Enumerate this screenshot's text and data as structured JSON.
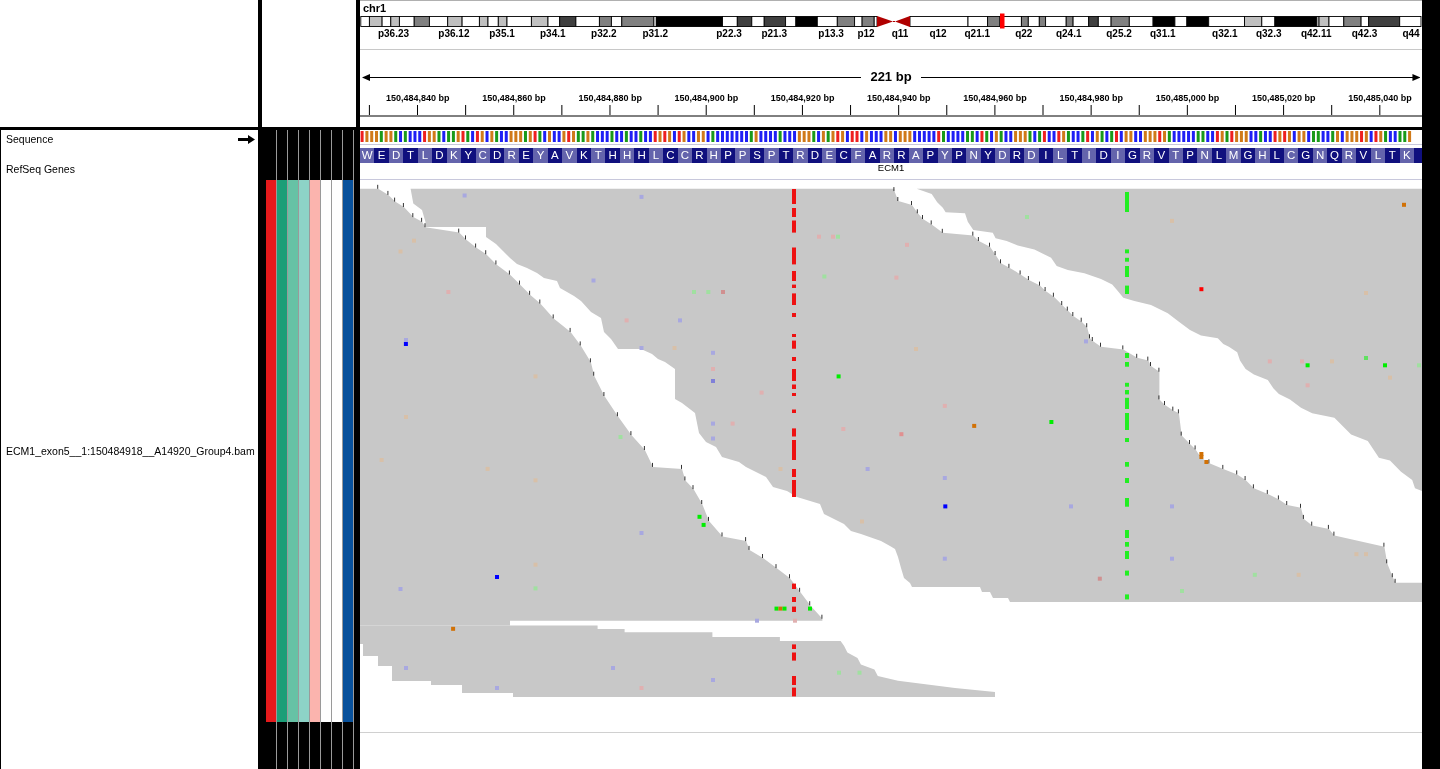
{
  "chromosome": {
    "name": "chr1",
    "band_labels": [
      "p36.23",
      "p36.12",
      "p35.1",
      "p34.1",
      "p32.2",
      "p31.2",
      "p22.3",
      "p21.3",
      "p13.3",
      "p12",
      "q11",
      "q12",
      "q21.1",
      "q22",
      "q24.1",
      "q25.2",
      "q31.1",
      "q32.1",
      "q32.3",
      "q42.11",
      "q42.3",
      "q44"
    ]
  },
  "ruler": {
    "span": "221 bp",
    "tick_labels": [
      "150,484,840 bp",
      "150,484,860 bp",
      "150,484,880 bp",
      "150,484,900 bp",
      "150,484,920 bp",
      "150,484,940 bp",
      "150,484,960 bp",
      "150,484,980 bp",
      "150,485,000 bp",
      "150,485,020 bp",
      "150,485,040 bp"
    ]
  },
  "tracks": [
    {
      "kind": "sequence",
      "name": "Sequence",
      "forward_strand": true
    },
    {
      "kind": "gene",
      "name": "RefSeq Genes",
      "gene": "ECM1",
      "amino_acids": [
        "W",
        "E",
        "D",
        "T",
        "L",
        "D",
        "K",
        "Y",
        "C",
        "D",
        "R",
        "E",
        "Y",
        "A",
        "V",
        "K",
        "T",
        "H",
        "H",
        "H",
        "L",
        "C",
        "C",
        "R",
        "H",
        "P",
        "P",
        "S",
        "P",
        "T",
        "R",
        "D",
        "E",
        "C",
        "F",
        "A",
        "R",
        "R",
        "A",
        "P",
        "Y",
        "P",
        "N",
        "Y",
        "D",
        "R",
        "D",
        "I",
        "L",
        "T",
        "I",
        "D",
        "I",
        "G",
        "R",
        "V",
        "T",
        "P",
        "N",
        "L",
        "M",
        "G",
        "H",
        "L",
        "C",
        "G",
        "N",
        "Q",
        "R",
        "V",
        "L",
        "T",
        "K"
      ]
    },
    {
      "kind": "alignment",
      "name": "ECM1_exon5__1:150484918__A14920_Group4.bam",
      "attributes": [
        {
          "color": "#e41a1c"
        },
        {
          "color": "#1b9e77"
        },
        {
          "color": "#66c2a5"
        },
        {
          "color": "#8dd3c7"
        },
        {
          "color": "#fbb4ae"
        },
        {
          "color": "#ffffff"
        },
        {
          "color": "#ffffff"
        },
        {
          "color": "#08519c"
        }
      ]
    }
  ]
}
